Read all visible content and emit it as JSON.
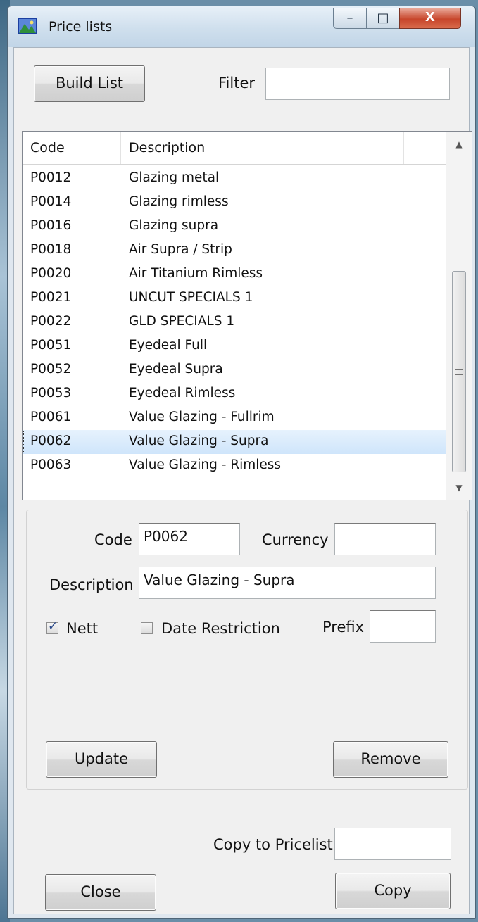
{
  "window": {
    "title": "Price lists",
    "minimize_glyph": "–",
    "maximize_glyph": "□",
    "close_glyph": "X"
  },
  "toolbar": {
    "build_list_label": "Build List",
    "filter_label": "Filter",
    "filter_value": ""
  },
  "list": {
    "columns": [
      "Code",
      "Description"
    ],
    "rows": [
      {
        "code": "P0012",
        "description": "Glazing metal"
      },
      {
        "code": "P0014",
        "description": "Glazing rimless"
      },
      {
        "code": "P0016",
        "description": "Glazing supra"
      },
      {
        "code": "P0018",
        "description": "Air Supra / Strip"
      },
      {
        "code": "P0020",
        "description": "Air Titanium Rimless"
      },
      {
        "code": "P0021",
        "description": "UNCUT SPECIALS 1"
      },
      {
        "code": "P0022",
        "description": "GLD SPECIALS 1"
      },
      {
        "code": "P0051",
        "description": "Eyedeal Full"
      },
      {
        "code": "P0052",
        "description": "Eyedeal Supra"
      },
      {
        "code": "P0053",
        "description": "Eyedeal Rimless"
      },
      {
        "code": "P0061",
        "description": "Value Glazing - Fullrim"
      },
      {
        "code": "P0062",
        "description": "Value Glazing - Supra"
      },
      {
        "code": "P0063",
        "description": "Value Glazing - Rimless"
      }
    ],
    "selected_index": 11
  },
  "details": {
    "code_label": "Code",
    "code_value": "P0062",
    "currency_label": "Currency",
    "currency_value": "",
    "description_label": "Description",
    "description_value": "Value Glazing - Supra",
    "nett_label": "Nett",
    "nett_checked": true,
    "date_restriction_label": "Date Restriction",
    "date_restriction_checked": false,
    "prefix_label": "Prefix",
    "prefix_value": "",
    "update_label": "Update",
    "remove_label": "Remove"
  },
  "footer": {
    "copy_to_label": "Copy to Pricelist",
    "copy_to_value": "",
    "close_label": "Close",
    "copy_label": "Copy"
  },
  "colors": {
    "selection": "#cfe5fb",
    "close_button": "#c7452b",
    "checkmark": "#2c4a8a"
  }
}
